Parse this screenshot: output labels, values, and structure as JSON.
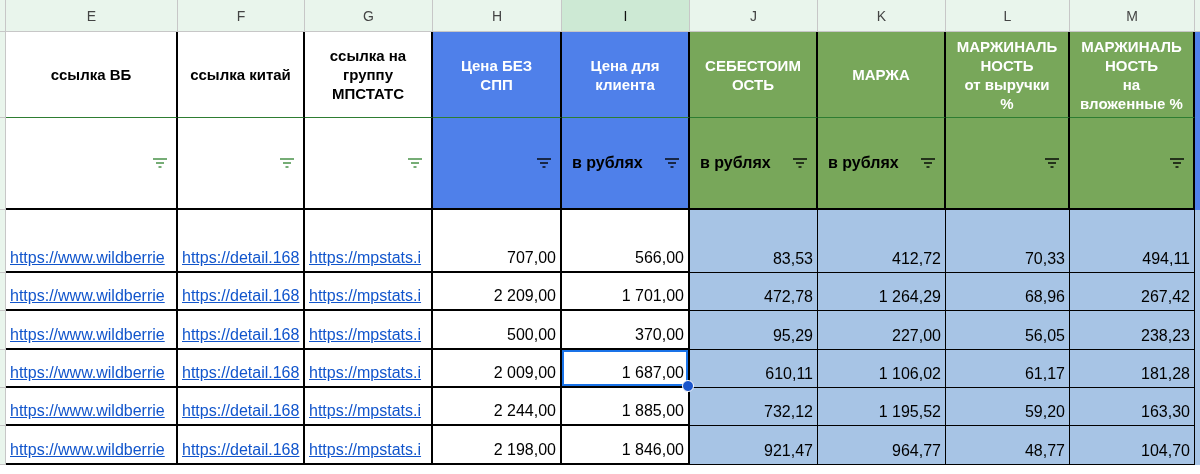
{
  "columns": [
    {
      "letter": "E",
      "selected": false,
      "kind": "link",
      "title": "ссылка ВБ"
    },
    {
      "letter": "F",
      "selected": false,
      "kind": "link",
      "title": "ссылка китай"
    },
    {
      "letter": "G",
      "selected": false,
      "kind": "link",
      "title": "ссылка на\nгруппу\nМПСТАТС"
    },
    {
      "letter": "H",
      "selected": false,
      "kind": "blue",
      "title": "Цена БЕЗ\nСПП"
    },
    {
      "letter": "I",
      "selected": true,
      "kind": "blue",
      "title": "Цена для\nклиента",
      "unit": "в рублях"
    },
    {
      "letter": "J",
      "selected": false,
      "kind": "green",
      "title": "СЕБЕСТОИМ\nОСТЬ",
      "unit": "в рублях"
    },
    {
      "letter": "K",
      "selected": false,
      "kind": "green",
      "title": "МАРЖА",
      "unit": "в рублях"
    },
    {
      "letter": "L",
      "selected": false,
      "kind": "green",
      "title": "МАРЖИНАЛЬ\nНОСТЬ\nот выручки\n%"
    },
    {
      "letter": "M",
      "selected": false,
      "kind": "green",
      "title": "МАРЖИНАЛЬ\nНОСТЬ\nна\nвложенные %"
    }
  ],
  "rows": [
    {
      "cells": [
        {
          "text": "https://www.wildberrie",
          "selected": false
        },
        {
          "text": "https://detail.168",
          "selected": false
        },
        {
          "text": "https://mpstats.i",
          "selected": false
        },
        {
          "text": "707,00",
          "selected": false
        },
        {
          "text": "566,00",
          "selected": false
        },
        {
          "text": "83,53",
          "selected": false
        },
        {
          "text": "412,72",
          "selected": false
        },
        {
          "text": "70,33",
          "selected": false
        },
        {
          "text": "494,11",
          "selected": false
        }
      ]
    },
    {
      "cells": [
        {
          "text": "https://www.wildberrie",
          "selected": false
        },
        {
          "text": "https://detail.168",
          "selected": false
        },
        {
          "text": "https://mpstats.i",
          "selected": false
        },
        {
          "text": "2 209,00",
          "selected": false
        },
        {
          "text": "1 701,00",
          "selected": false
        },
        {
          "text": "472,78",
          "selected": false
        },
        {
          "text": "1 264,29",
          "selected": false
        },
        {
          "text": "68,96",
          "selected": false
        },
        {
          "text": "267,42",
          "selected": false
        }
      ]
    },
    {
      "cells": [
        {
          "text": "https://www.wildberrie",
          "selected": false
        },
        {
          "text": "https://detail.168",
          "selected": false
        },
        {
          "text": "https://mpstats.i",
          "selected": false
        },
        {
          "text": "500,00",
          "selected": false
        },
        {
          "text": "370,00",
          "selected": false
        },
        {
          "text": "95,29",
          "selected": false
        },
        {
          "text": "227,00",
          "selected": false
        },
        {
          "text": "56,05",
          "selected": false
        },
        {
          "text": "238,23",
          "selected": false
        }
      ]
    },
    {
      "cells": [
        {
          "text": "https://www.wildberrie",
          "selected": false
        },
        {
          "text": "https://detail.168",
          "selected": false
        },
        {
          "text": "https://mpstats.i",
          "selected": false
        },
        {
          "text": "2 009,00",
          "selected": false
        },
        {
          "text": "1 687,00",
          "selected": true
        },
        {
          "text": "610,11",
          "selected": false
        },
        {
          "text": "1 106,02",
          "selected": false
        },
        {
          "text": "61,17",
          "selected": false
        },
        {
          "text": "181,28",
          "selected": false
        }
      ]
    },
    {
      "cells": [
        {
          "text": "https://www.wildberrie",
          "selected": false
        },
        {
          "text": "https://detail.168",
          "selected": false
        },
        {
          "text": "https://mpstats.i",
          "selected": false
        },
        {
          "text": "2 244,00",
          "selected": false
        },
        {
          "text": "1 885,00",
          "selected": false
        },
        {
          "text": "732,12",
          "selected": false
        },
        {
          "text": "1 195,52",
          "selected": false
        },
        {
          "text": "59,20",
          "selected": false
        },
        {
          "text": "163,30",
          "selected": false
        }
      ]
    },
    {
      "cells": [
        {
          "text": "https://www.wildberrie",
          "selected": false
        },
        {
          "text": "https://detail.168",
          "selected": false
        },
        {
          "text": "https://mpstats.i",
          "selected": false
        },
        {
          "text": "2 198,00",
          "selected": false
        },
        {
          "text": "1 846,00",
          "selected": false
        },
        {
          "text": "921,47",
          "selected": false
        },
        {
          "text": "964,77",
          "selected": false
        },
        {
          "text": "48,77",
          "selected": false
        },
        {
          "text": "104,70",
          "selected": false
        }
      ]
    }
  ]
}
